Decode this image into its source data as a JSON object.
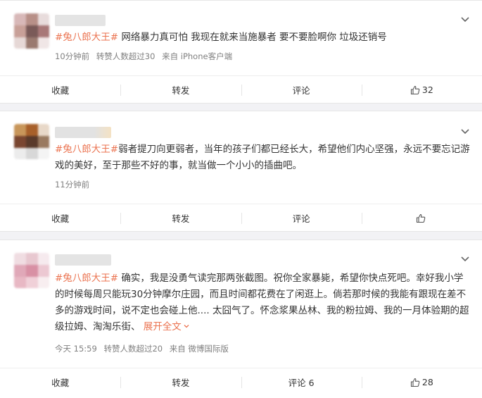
{
  "posts": [
    {
      "topic": "#兔八郎大王#",
      "text": " 网络暴力真可怕 我现在就来当施暴者 要不要脸啊你 垃圾还销号",
      "time": "10分钟前",
      "repost_info": "转赞人数超过30",
      "source": "来自 iPhone客户端",
      "actions": {
        "favorite": "收藏",
        "repost": "转发",
        "comment": "评论",
        "like_count": "32"
      }
    },
    {
      "topic": "#兔八郎大王#",
      "text": "弱者提刀向更弱者，当年的孩子们都已经长大，希望他们内心坚强，永远不要忘记游戏的美好，至于那些不好的事，就当做一个小小的插曲吧。",
      "time": "11分钟前",
      "actions": {
        "favorite": "收藏",
        "repost": "转发",
        "comment": "评论",
        "like_count": ""
      }
    },
    {
      "topic": "#兔八郎大王#",
      "text": " 确实，我是没勇气读完那两张截图。祝你全家暴毙，希望你快点死吧。幸好我小学的时候每周只能玩30分钟摩尔庄园，而且时间都花费在了闲逛上。倘若那时候的我能有跟现在差不多的游戏时间，说不定也会碰上他.... 太囧气了。怀念浆果丛林、我的粉拉姆、我的一月体验期的超级拉姆、淘淘乐街、",
      "expand": "展开全文",
      "time": "今天 15:59",
      "repost_info": "转赞人数超过20",
      "source": "来自 微博国际版",
      "actions": {
        "favorite": "收藏",
        "repost": "转发",
        "comment": "评论 6",
        "like_count": "28"
      }
    }
  ],
  "icons": {
    "chevron": "chevron-down-icon",
    "like": "thumbs-up-icon"
  },
  "colors": {
    "topic": "#eb7350",
    "meta": "#808080",
    "background": "#f2f2f5"
  }
}
